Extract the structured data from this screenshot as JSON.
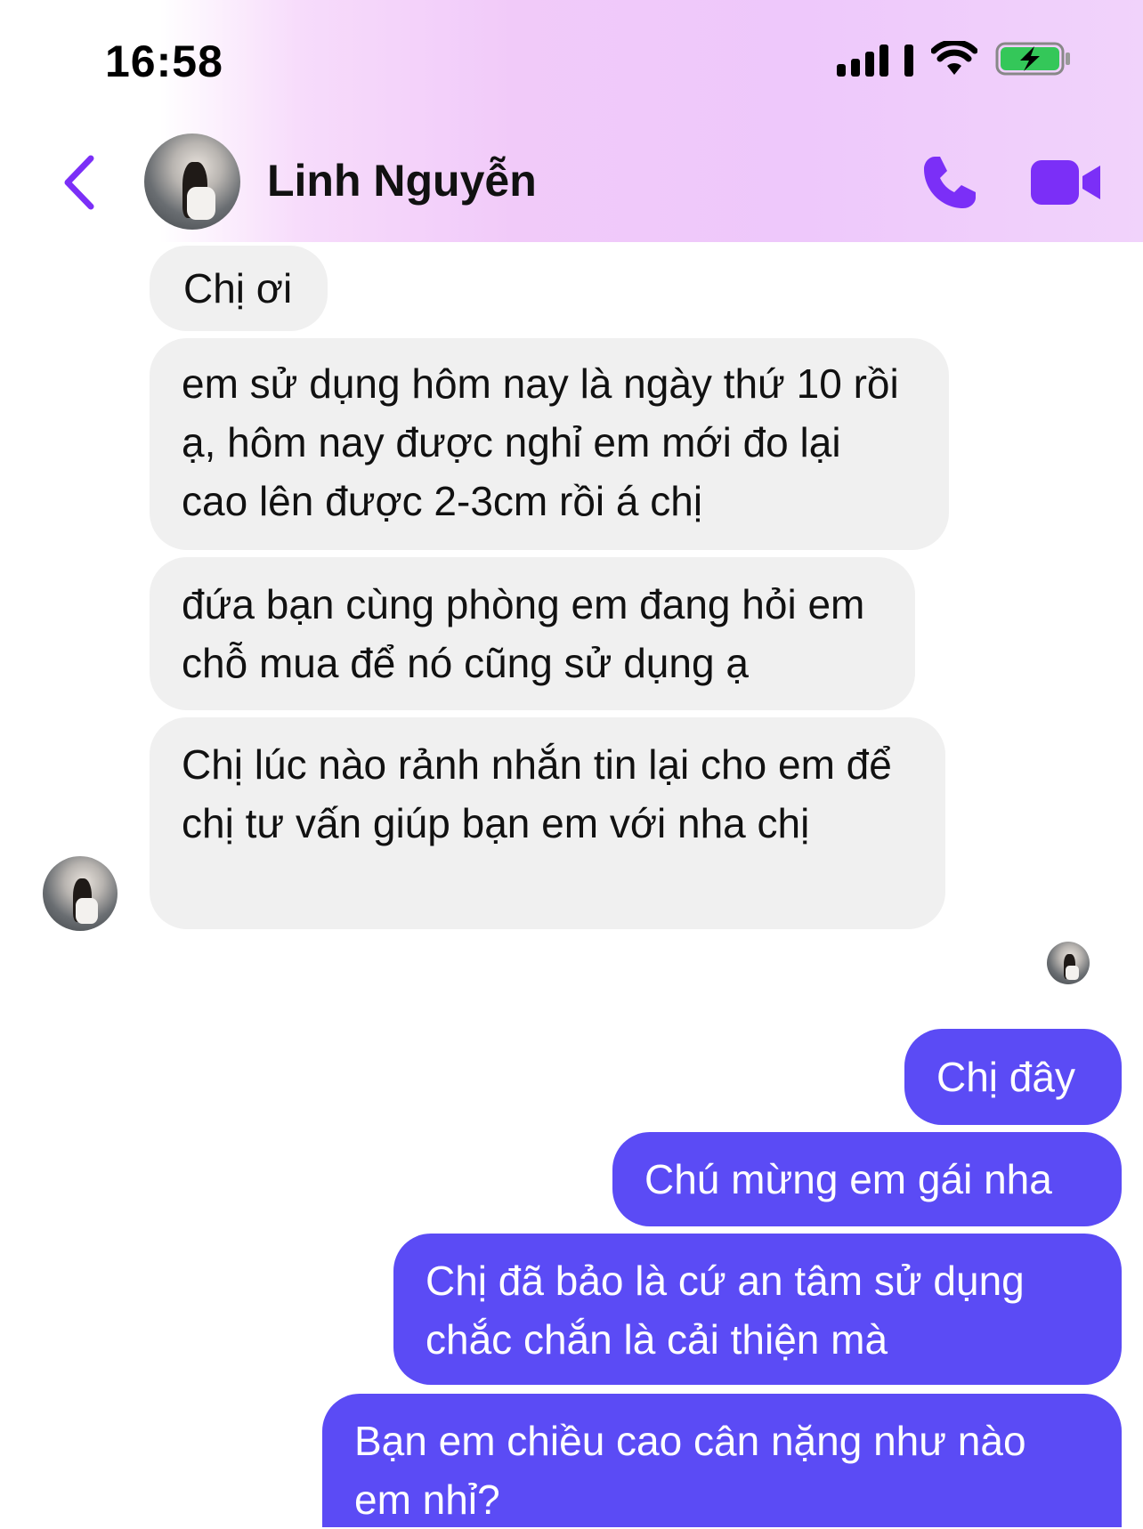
{
  "status_bar": {
    "time": "16:58"
  },
  "header": {
    "contact_name": "Linh Nguyễn"
  },
  "messages": {
    "received": [
      "Chị ơi",
      "em sử dụng hôm nay là ngày thứ 10 rồi ạ, hôm nay được nghỉ em mới đo lại cao lên được 2-3cm rồi á chị",
      "đứa bạn cùng phòng em đang hỏi em chỗ mua để nó cũng sử dụng ạ",
      "Chị lúc nào rảnh nhắn tin lại cho em để chị tư vấn giúp bạn em với nha chị"
    ],
    "sent": [
      "Chị đây",
      "Chú mừng em gái nha",
      "Chị đã bảo là cứ an tâm sử dụng chắc chắn là cải thiện mà",
      "Bạn em chiều cao cân nặng như nào em nhỉ?"
    ]
  },
  "colors": {
    "accent": "#7b2ff7",
    "sent_bubble": "#5b4bf5",
    "received_bubble": "#f0f0f0",
    "battery_fill": "#34c759"
  },
  "icons": [
    "back-chevron-icon",
    "phone-icon",
    "video-camera-icon",
    "signal-icon",
    "wifi-icon",
    "battery-charging-icon"
  ]
}
